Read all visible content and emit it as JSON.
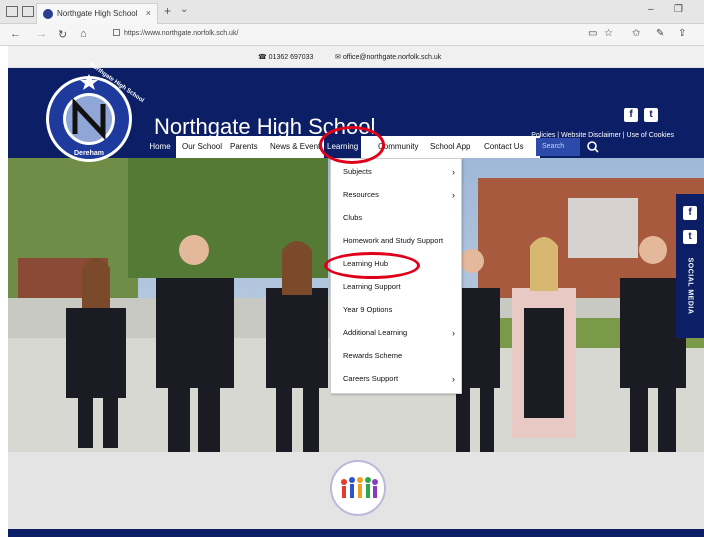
{
  "browser": {
    "tab_title": "Northgate High School",
    "tab_close": "×",
    "new_tab": "+",
    "tab_menu": "⌄",
    "url": "https://www.northgate.norfolk.sch.uk/",
    "minimize": "–",
    "restore": "❐"
  },
  "site": {
    "phone": "01362 697033",
    "email": "office@northgate.norfolk.sch.uk",
    "title": "Northgate High School",
    "crest_top": "Northgate High School",
    "crest_bottom": "Dereham",
    "policies": "Policies | Website Disclaimer | Use of Cookies",
    "social_fb": "f",
    "social_tw": "t"
  },
  "nav": {
    "home": "Home",
    "items": [
      {
        "label": "Our School"
      },
      {
        "label": "Parents"
      },
      {
        "label": "News & Event"
      },
      {
        "label": "Learning"
      },
      {
        "label": "Community"
      },
      {
        "label": "School App"
      },
      {
        "label": "Contact Us"
      }
    ],
    "search_placeholder": "Search"
  },
  "dropdown": {
    "items": [
      {
        "label": "Subjects",
        "arrow": "›"
      },
      {
        "label": "Resources",
        "arrow": "›"
      },
      {
        "label": "Clubs",
        "arrow": ""
      },
      {
        "label": "Homework and Study Support",
        "arrow": ""
      },
      {
        "label": "Learning Hub",
        "arrow": ""
      },
      {
        "label": "Learning Support",
        "arrow": ""
      },
      {
        "label": "Year 9 Options",
        "arrow": ""
      },
      {
        "label": "Additional Learning",
        "arrow": "›"
      },
      {
        "label": "Rewards Scheme",
        "arrow": ""
      },
      {
        "label": "Careers Support",
        "arrow": "›"
      }
    ]
  },
  "side_social": {
    "label": "SOCIAL MEDIA",
    "fb": "f",
    "tw": "t"
  },
  "colors": {
    "navy": "#0c1f66",
    "highlight": "#e0001a"
  }
}
